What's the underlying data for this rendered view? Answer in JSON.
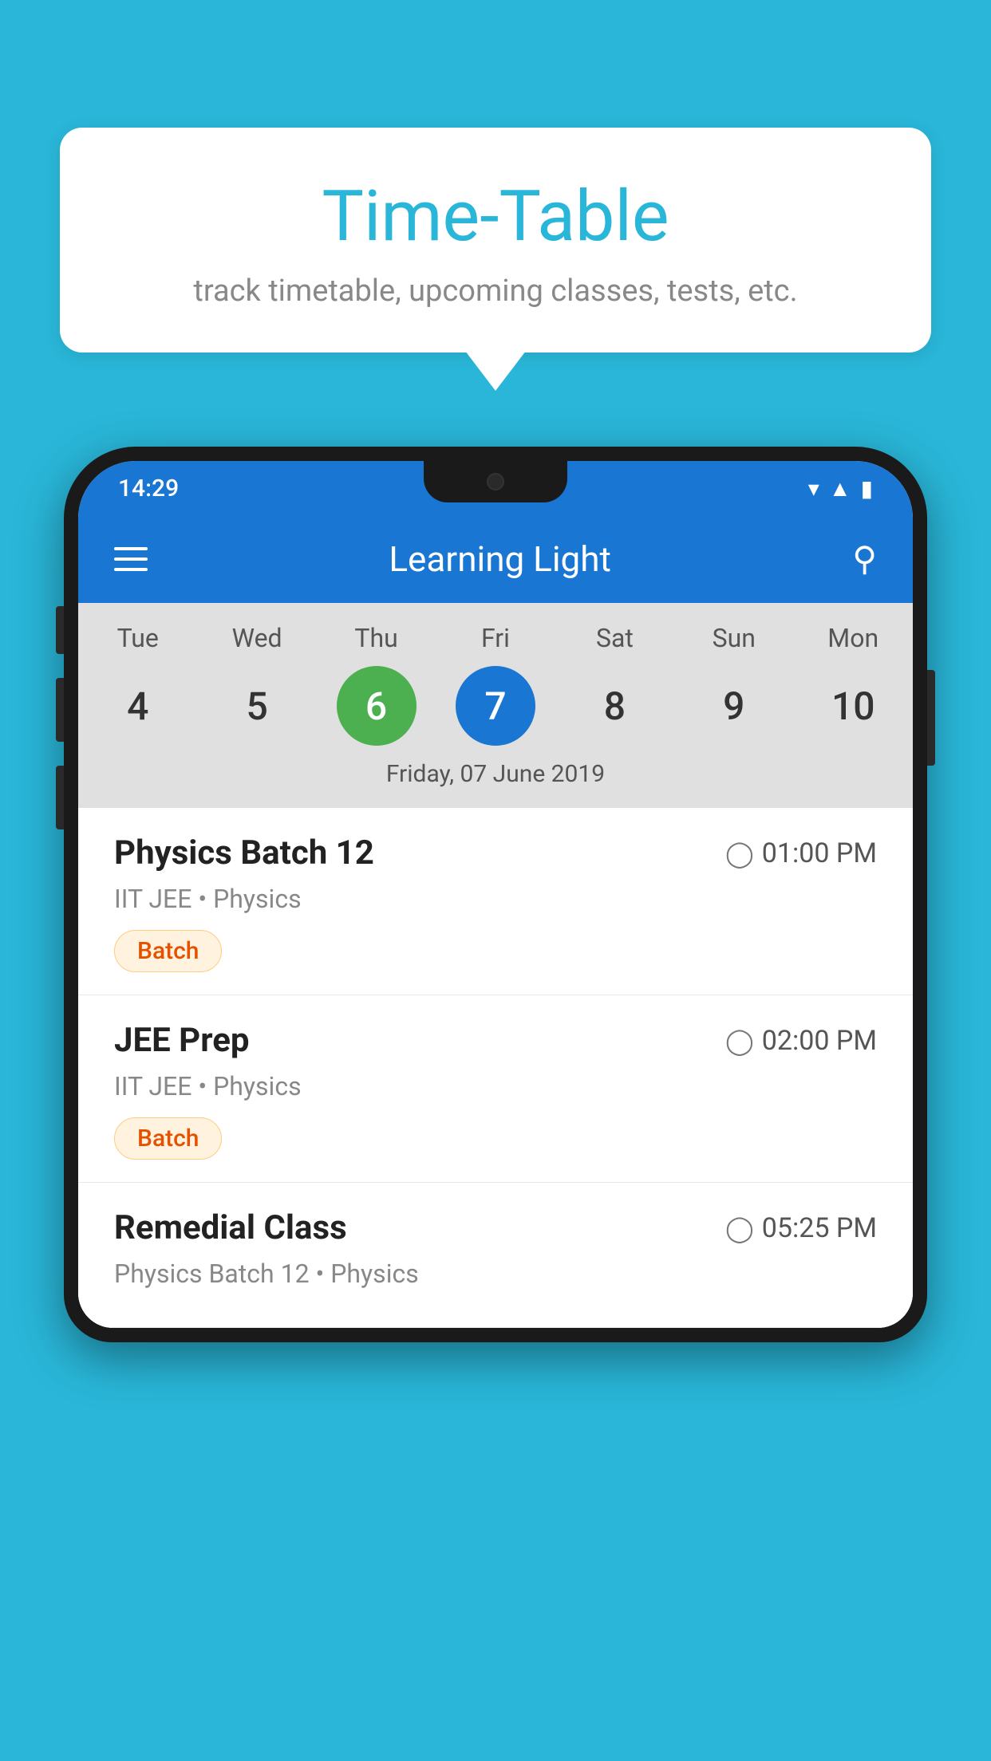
{
  "background_color": "#29B6D8",
  "tooltip": {
    "title": "Time-Table",
    "subtitle": "track timetable, upcoming classes, tests, etc."
  },
  "phone": {
    "status_bar": {
      "time": "14:29"
    },
    "toolbar": {
      "title": "Learning Light",
      "menu_label": "menu",
      "search_label": "search"
    },
    "calendar": {
      "days": [
        {
          "label": "Tue",
          "number": "4"
        },
        {
          "label": "Wed",
          "number": "5"
        },
        {
          "label": "Thu",
          "number": "6",
          "state": "today"
        },
        {
          "label": "Fri",
          "number": "7",
          "state": "selected"
        },
        {
          "label": "Sat",
          "number": "8"
        },
        {
          "label": "Sun",
          "number": "9"
        },
        {
          "label": "Mon",
          "number": "10"
        }
      ],
      "selected_date": "Friday, 07 June 2019"
    },
    "schedule": [
      {
        "title": "Physics Batch 12",
        "time": "01:00 PM",
        "meta": "IIT JEE • Physics",
        "tag": "Batch"
      },
      {
        "title": "JEE Prep",
        "time": "02:00 PM",
        "meta": "IIT JEE • Physics",
        "tag": "Batch"
      },
      {
        "title": "Remedial Class",
        "time": "05:25 PM",
        "meta": "Physics Batch 12 • Physics",
        "tag": ""
      }
    ]
  }
}
